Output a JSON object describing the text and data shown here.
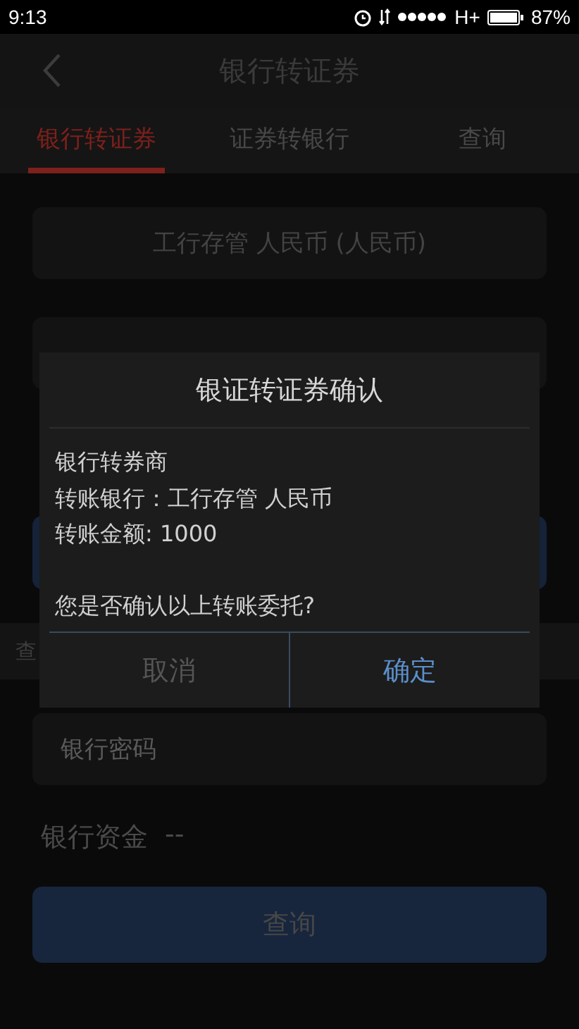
{
  "status_bar": {
    "time": "9:13",
    "network": "H+",
    "battery": "87%"
  },
  "nav": {
    "title": "银行转证券"
  },
  "tabs": [
    {
      "label": "银行转证券",
      "selected": true
    },
    {
      "label": "证券转银行",
      "selected": false
    },
    {
      "label": "查询",
      "selected": false
    }
  ],
  "form": {
    "account": "工行存管 人民币 (人民币)",
    "strip_label": "查",
    "password_placeholder": "银行密码",
    "funds_label": "银行资金",
    "funds_value": "--",
    "query_button": "查询"
  },
  "dialog": {
    "title": "银证转证券确认",
    "lines": [
      "银行转券商",
      "转账银行：工行存管 人民币",
      "转账金额: 1000"
    ],
    "question": "您是否确认以上转账委托?",
    "cancel": "取消",
    "confirm": "确定"
  }
}
